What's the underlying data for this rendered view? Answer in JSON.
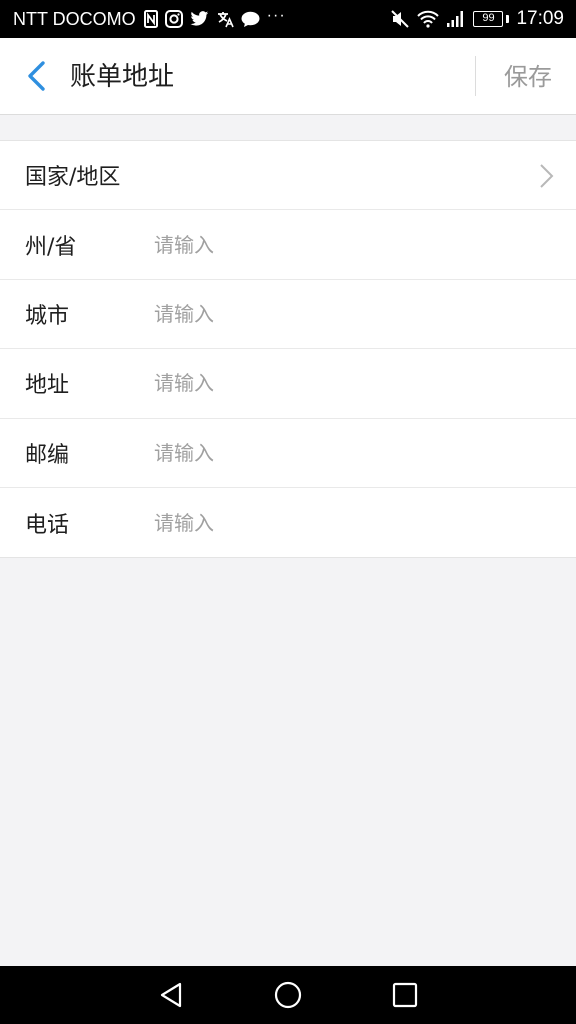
{
  "status_bar": {
    "carrier": "NTT DOCOMO",
    "battery": "99",
    "time": "17:09",
    "more": "···",
    "left_icons": [
      "nfc-icon",
      "instagram-icon",
      "twitter-icon",
      "translate-icon",
      "chat-bubble-icon"
    ],
    "right_icons": [
      "mute-icon",
      "wifi-icon",
      "signal-icon",
      "battery-icon"
    ]
  },
  "header": {
    "title": "账单地址",
    "save_label": "保存",
    "back_icon": "chevron-left-icon",
    "accent_color": "#2f8fdf"
  },
  "form": {
    "rows": [
      {
        "label": "国家/地区",
        "type": "select",
        "icon": "chevron-right-icon"
      },
      {
        "label": "州/省",
        "placeholder": "请输入",
        "value": ""
      },
      {
        "label": "城市",
        "placeholder": "请输入",
        "value": ""
      },
      {
        "label": "地址",
        "placeholder": "请输入",
        "value": ""
      },
      {
        "label": "邮编",
        "placeholder": "请输入",
        "value": ""
      },
      {
        "label": "电话",
        "placeholder": "请输入",
        "value": ""
      }
    ]
  },
  "nav_bar": {
    "buttons": [
      "back-triangle-icon",
      "home-circle-icon",
      "recents-square-icon"
    ]
  }
}
